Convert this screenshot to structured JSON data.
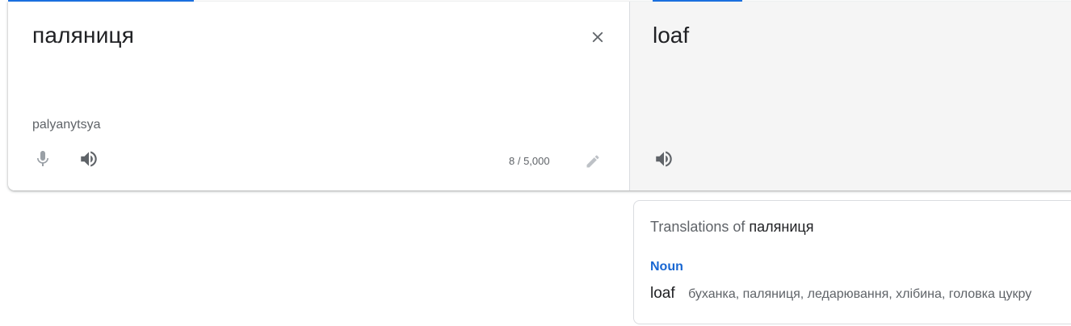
{
  "source": {
    "text": "паляниця",
    "transliteration": "palyanytsya",
    "char_count": "8 / 5,000",
    "clear_icon": "close-icon",
    "mic_icon": "microphone-icon",
    "listen_icon": "volume-icon",
    "edit_icon": "pencil-icon"
  },
  "target": {
    "text": "loaf",
    "listen_icon": "volume-icon"
  },
  "dictionary": {
    "heading_prefix": "Translations of",
    "heading_word": "паляниця",
    "entries": [
      {
        "part_of_speech": "Noun",
        "term": "loaf",
        "synonyms": "буханка, паляниця, ледарювання, хлібина, головка цукру"
      }
    ]
  },
  "colors": {
    "accent": "#1a73e8",
    "pos_label": "#1967d2",
    "target_bg": "#f5f5f5"
  }
}
